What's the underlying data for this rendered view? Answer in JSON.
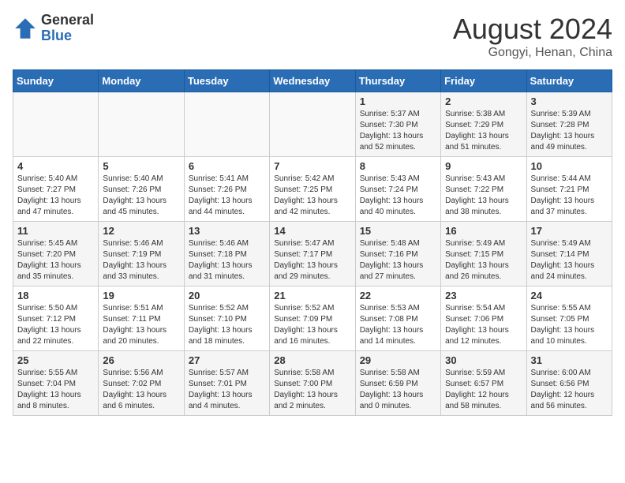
{
  "header": {
    "logo_general": "General",
    "logo_blue": "Blue",
    "month_year": "August 2024",
    "location": "Gongyi, Henan, China"
  },
  "days_of_week": [
    "Sunday",
    "Monday",
    "Tuesday",
    "Wednesday",
    "Thursday",
    "Friday",
    "Saturday"
  ],
  "weeks": [
    [
      {
        "day": "",
        "sunrise": "",
        "sunset": "",
        "daylight": ""
      },
      {
        "day": "",
        "sunrise": "",
        "sunset": "",
        "daylight": ""
      },
      {
        "day": "",
        "sunrise": "",
        "sunset": "",
        "daylight": ""
      },
      {
        "day": "",
        "sunrise": "",
        "sunset": "",
        "daylight": ""
      },
      {
        "day": "1",
        "sunrise": "Sunrise: 5:37 AM",
        "sunset": "Sunset: 7:30 PM",
        "daylight": "Daylight: 13 hours and 52 minutes."
      },
      {
        "day": "2",
        "sunrise": "Sunrise: 5:38 AM",
        "sunset": "Sunset: 7:29 PM",
        "daylight": "Daylight: 13 hours and 51 minutes."
      },
      {
        "day": "3",
        "sunrise": "Sunrise: 5:39 AM",
        "sunset": "Sunset: 7:28 PM",
        "daylight": "Daylight: 13 hours and 49 minutes."
      }
    ],
    [
      {
        "day": "4",
        "sunrise": "Sunrise: 5:40 AM",
        "sunset": "Sunset: 7:27 PM",
        "daylight": "Daylight: 13 hours and 47 minutes."
      },
      {
        "day": "5",
        "sunrise": "Sunrise: 5:40 AM",
        "sunset": "Sunset: 7:26 PM",
        "daylight": "Daylight: 13 hours and 45 minutes."
      },
      {
        "day": "6",
        "sunrise": "Sunrise: 5:41 AM",
        "sunset": "Sunset: 7:26 PM",
        "daylight": "Daylight: 13 hours and 44 minutes."
      },
      {
        "day": "7",
        "sunrise": "Sunrise: 5:42 AM",
        "sunset": "Sunset: 7:25 PM",
        "daylight": "Daylight: 13 hours and 42 minutes."
      },
      {
        "day": "8",
        "sunrise": "Sunrise: 5:43 AM",
        "sunset": "Sunset: 7:24 PM",
        "daylight": "Daylight: 13 hours and 40 minutes."
      },
      {
        "day": "9",
        "sunrise": "Sunrise: 5:43 AM",
        "sunset": "Sunset: 7:22 PM",
        "daylight": "Daylight: 13 hours and 38 minutes."
      },
      {
        "day": "10",
        "sunrise": "Sunrise: 5:44 AM",
        "sunset": "Sunset: 7:21 PM",
        "daylight": "Daylight: 13 hours and 37 minutes."
      }
    ],
    [
      {
        "day": "11",
        "sunrise": "Sunrise: 5:45 AM",
        "sunset": "Sunset: 7:20 PM",
        "daylight": "Daylight: 13 hours and 35 minutes."
      },
      {
        "day": "12",
        "sunrise": "Sunrise: 5:46 AM",
        "sunset": "Sunset: 7:19 PM",
        "daylight": "Daylight: 13 hours and 33 minutes."
      },
      {
        "day": "13",
        "sunrise": "Sunrise: 5:46 AM",
        "sunset": "Sunset: 7:18 PM",
        "daylight": "Daylight: 13 hours and 31 minutes."
      },
      {
        "day": "14",
        "sunrise": "Sunrise: 5:47 AM",
        "sunset": "Sunset: 7:17 PM",
        "daylight": "Daylight: 13 hours and 29 minutes."
      },
      {
        "day": "15",
        "sunrise": "Sunrise: 5:48 AM",
        "sunset": "Sunset: 7:16 PM",
        "daylight": "Daylight: 13 hours and 27 minutes."
      },
      {
        "day": "16",
        "sunrise": "Sunrise: 5:49 AM",
        "sunset": "Sunset: 7:15 PM",
        "daylight": "Daylight: 13 hours and 26 minutes."
      },
      {
        "day": "17",
        "sunrise": "Sunrise: 5:49 AM",
        "sunset": "Sunset: 7:14 PM",
        "daylight": "Daylight: 13 hours and 24 minutes."
      }
    ],
    [
      {
        "day": "18",
        "sunrise": "Sunrise: 5:50 AM",
        "sunset": "Sunset: 7:12 PM",
        "daylight": "Daylight: 13 hours and 22 minutes."
      },
      {
        "day": "19",
        "sunrise": "Sunrise: 5:51 AM",
        "sunset": "Sunset: 7:11 PM",
        "daylight": "Daylight: 13 hours and 20 minutes."
      },
      {
        "day": "20",
        "sunrise": "Sunrise: 5:52 AM",
        "sunset": "Sunset: 7:10 PM",
        "daylight": "Daylight: 13 hours and 18 minutes."
      },
      {
        "day": "21",
        "sunrise": "Sunrise: 5:52 AM",
        "sunset": "Sunset: 7:09 PM",
        "daylight": "Daylight: 13 hours and 16 minutes."
      },
      {
        "day": "22",
        "sunrise": "Sunrise: 5:53 AM",
        "sunset": "Sunset: 7:08 PM",
        "daylight": "Daylight: 13 hours and 14 minutes."
      },
      {
        "day": "23",
        "sunrise": "Sunrise: 5:54 AM",
        "sunset": "Sunset: 7:06 PM",
        "daylight": "Daylight: 13 hours and 12 minutes."
      },
      {
        "day": "24",
        "sunrise": "Sunrise: 5:55 AM",
        "sunset": "Sunset: 7:05 PM",
        "daylight": "Daylight: 13 hours and 10 minutes."
      }
    ],
    [
      {
        "day": "25",
        "sunrise": "Sunrise: 5:55 AM",
        "sunset": "Sunset: 7:04 PM",
        "daylight": "Daylight: 13 hours and 8 minutes."
      },
      {
        "day": "26",
        "sunrise": "Sunrise: 5:56 AM",
        "sunset": "Sunset: 7:02 PM",
        "daylight": "Daylight: 13 hours and 6 minutes."
      },
      {
        "day": "27",
        "sunrise": "Sunrise: 5:57 AM",
        "sunset": "Sunset: 7:01 PM",
        "daylight": "Daylight: 13 hours and 4 minutes."
      },
      {
        "day": "28",
        "sunrise": "Sunrise: 5:58 AM",
        "sunset": "Sunset: 7:00 PM",
        "daylight": "Daylight: 13 hours and 2 minutes."
      },
      {
        "day": "29",
        "sunrise": "Sunrise: 5:58 AM",
        "sunset": "Sunset: 6:59 PM",
        "daylight": "Daylight: 13 hours and 0 minutes."
      },
      {
        "day": "30",
        "sunrise": "Sunrise: 5:59 AM",
        "sunset": "Sunset: 6:57 PM",
        "daylight": "Daylight: 12 hours and 58 minutes."
      },
      {
        "day": "31",
        "sunrise": "Sunrise: 6:00 AM",
        "sunset": "Sunset: 6:56 PM",
        "daylight": "Daylight: 12 hours and 56 minutes."
      }
    ]
  ]
}
